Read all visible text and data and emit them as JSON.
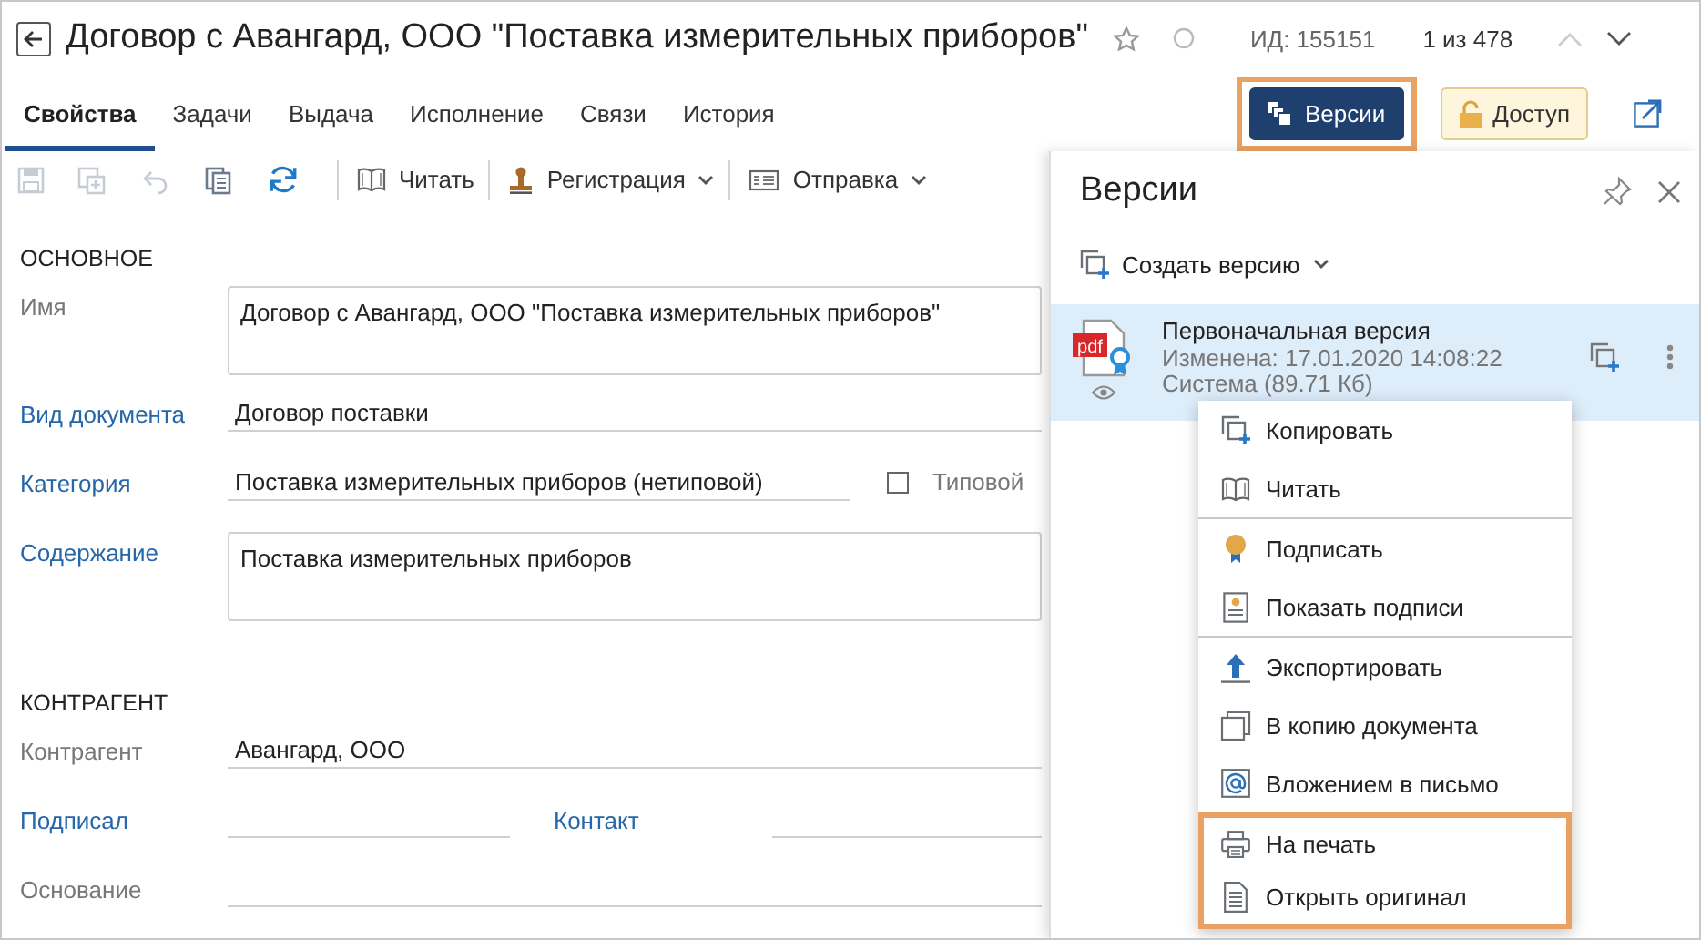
{
  "header": {
    "title": "Договор с Авангард, ООО \"Поставка измерительных приборов\"",
    "favorite": false,
    "id_label": "ИД: 155151",
    "counter": "1 из 478",
    "prev_disabled": true,
    "next_disabled": false
  },
  "tabs": [
    {
      "label": "Свойства",
      "selected": true
    },
    {
      "label": "Задачи",
      "selected": false
    },
    {
      "label": "Выдача",
      "selected": false
    },
    {
      "label": "Исполнение",
      "selected": false
    },
    {
      "label": "Связи",
      "selected": false
    },
    {
      "label": "История",
      "selected": false
    }
  ],
  "header_buttons": [
    {
      "label": "Версии",
      "kind": "primary",
      "highlighted": true
    },
    {
      "label": "Доступ",
      "kind": "access",
      "highlighted": false
    }
  ],
  "toolbar": {
    "icon_buttons": [
      {
        "disabled": true
      },
      {
        "disabled": true
      },
      {
        "disabled": true
      },
      {
        "disabled": false
      },
      {
        "disabled": false
      }
    ],
    "buttons": [
      {
        "label": "Читать",
        "dropdown": false
      },
      {
        "label": "Регистрация",
        "dropdown": true
      },
      {
        "label": "Отправка",
        "dropdown": true
      }
    ]
  },
  "form": [
    {
      "kind": "section",
      "label": "ОСНОВНОЕ"
    },
    {
      "kind": "textarea",
      "label": "Имя",
      "link": false,
      "value": "Договор с Авангард, ООО \"Поставка измерительных приборов\""
    },
    {
      "kind": "line",
      "label": "Вид документа",
      "link": true,
      "value": "Договор поставки"
    },
    {
      "kind": "line",
      "label": "Категория",
      "link": true,
      "value": "Поставка измерительных приборов (нетиповой)",
      "checkbox": {
        "label": "Типовой",
        "checked": false
      }
    },
    {
      "kind": "textarea",
      "label": "Содержание",
      "link": true,
      "value": "Поставка измерительных приборов"
    },
    {
      "kind": "section",
      "label": "КОНТРАГЕНТ"
    },
    {
      "kind": "line",
      "label": "Контрагент",
      "link": false,
      "value": "Авангард, ООО"
    },
    {
      "kind": "pair",
      "label": "Подписал",
      "link": true,
      "label2": "Контакт",
      "link2": true
    },
    {
      "kind": "line",
      "label": "Основание",
      "link": false
    }
  ],
  "versions_panel": {
    "title": "Версии",
    "create_label": "Создать версию",
    "versions": [
      {
        "file_type": "pdf",
        "name": "Первоначальная версия",
        "modified": "Изменена: 17.01.2020 14:08:22",
        "author": "Система (89.71 Кб)",
        "selected": true
      }
    ]
  },
  "context_menu": {
    "groups": [
      [
        {
          "label": "Копировать",
          "highlighted": false
        },
        {
          "label": "Читать",
          "highlighted": false
        }
      ],
      [
        {
          "label": "Подписать",
          "highlighted": false
        },
        {
          "label": "Показать подписи",
          "highlighted": false
        }
      ],
      [
        {
          "label": "Экспортировать",
          "highlighted": false
        },
        {
          "label": "В копию документа",
          "highlighted": false
        },
        {
          "label": "Вложением в письмо",
          "highlighted": false
        },
        {
          "label": "На печать",
          "highlighted": true
        },
        {
          "label": "Открыть оригинал",
          "highlighted": true
        }
      ]
    ]
  }
}
